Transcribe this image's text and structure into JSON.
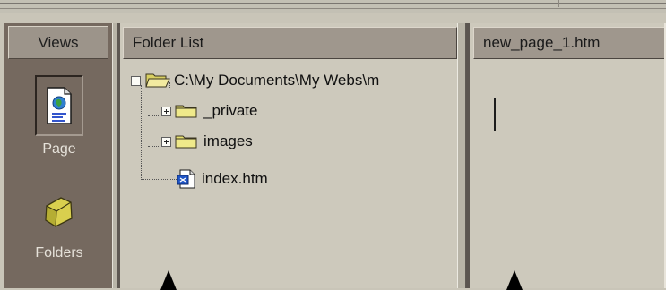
{
  "views": {
    "header": "Views",
    "items": [
      {
        "label": "Page",
        "icon": "page-view-icon"
      },
      {
        "label": "Folders",
        "icon": "folder-view-icon"
      }
    ]
  },
  "folder_list": {
    "header": "Folder List",
    "root": "C:\\My Documents\\My Webs\\m",
    "items": [
      {
        "label": "_private",
        "icon": "folder-icon"
      },
      {
        "label": "images",
        "icon": "folder-icon"
      },
      {
        "label": "index.htm",
        "icon": "html-file-icon"
      }
    ]
  },
  "editor": {
    "tab_title": "new_page_1.htm"
  },
  "colors": {
    "views_bg": "#75695f",
    "pane_bg": "#cdc9bc",
    "header_bg": "#9f978d"
  }
}
